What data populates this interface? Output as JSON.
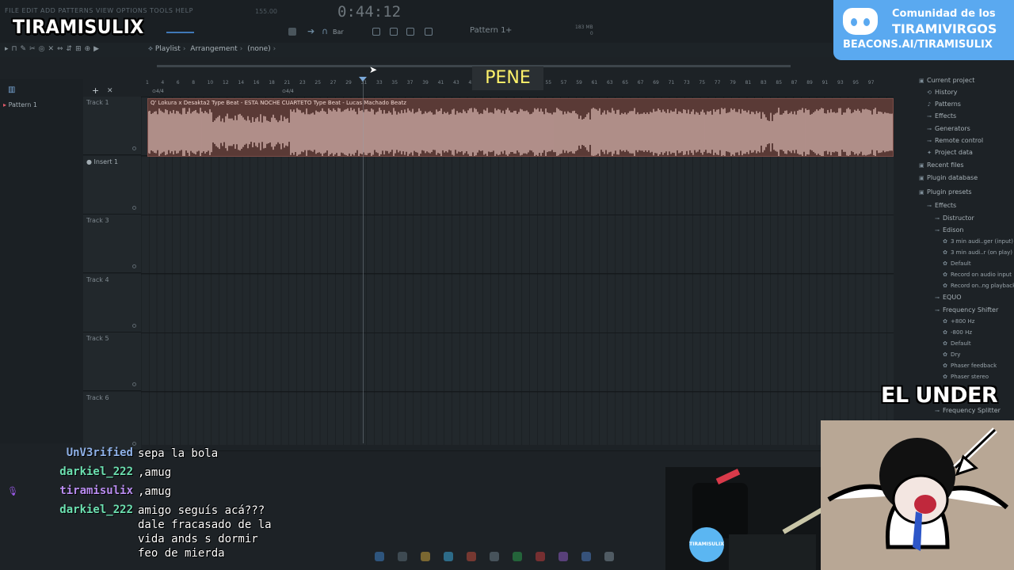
{
  "menu": {
    "text": "FILE  EDIT  ADD  PATTERNS  VIEW  OPTIONS  TOOLS  HELP"
  },
  "logo": "TIRAMISULIX",
  "transport": {
    "time": "0:44:12",
    "tempo_label": "155.00",
    "snap": "Bar",
    "pattern": "Pattern 1",
    "plus": "+",
    "memory_value": "183 MB",
    "memory_cpu": "0"
  },
  "breadcrumb": {
    "a": "Playlist",
    "b": "Arrangement",
    "c": "(none)"
  },
  "pattern_list": {
    "item": "Pattern 1"
  },
  "ruler": {
    "ticks": [
      "1",
      "4",
      "6",
      "8",
      "10",
      "12",
      "14",
      "16",
      "18",
      "21",
      "23",
      "25",
      "27",
      "29",
      "31",
      "33",
      "35",
      "37",
      "39",
      "41",
      "43",
      "45",
      "47",
      "49",
      "51",
      "53",
      "55",
      "57",
      "59",
      "61",
      "63",
      "65",
      "67",
      "69",
      "71",
      "73",
      "75",
      "77",
      "79",
      "81",
      "83",
      "85",
      "87",
      "89",
      "91",
      "93",
      "95",
      "97"
    ],
    "time_sig_a": "4/4",
    "time_sig_b": "4/4"
  },
  "tracks": [
    {
      "name": "Track 1"
    },
    {
      "name": "Insert 1"
    },
    {
      "name": "Track 3"
    },
    {
      "name": "Track 4"
    },
    {
      "name": "Track 5"
    },
    {
      "name": "Track 6"
    }
  ],
  "clip": {
    "title": "Q' Lokura x Desakta2 Type Beat - ESTA NOCHE  CUARTETO Type Beat - Lucas Machado Beatz"
  },
  "overlay": {
    "pene": "PENE",
    "el_under": "EL UNDER"
  },
  "browser": {
    "items": [
      {
        "label": "Current project",
        "icon": "folder-icon",
        "level": 0
      },
      {
        "label": "History",
        "icon": "history-icon",
        "level": 1
      },
      {
        "label": "Patterns",
        "icon": "pattern-icon",
        "level": 1
      },
      {
        "label": "Effects",
        "icon": "plug-icon",
        "level": 1
      },
      {
        "label": "Generators",
        "icon": "plug-icon",
        "level": 1
      },
      {
        "label": "Remote control",
        "icon": "plug-icon",
        "level": 1
      },
      {
        "label": "Project data",
        "icon": "data-icon",
        "level": 1
      },
      {
        "label": "Recent files",
        "icon": "folder-icon",
        "level": 0
      },
      {
        "label": "Plugin database",
        "icon": "folder-icon",
        "level": 0
      },
      {
        "label": "Plugin presets",
        "icon": "folder-icon",
        "level": 0
      },
      {
        "label": "Effects",
        "icon": "plug-icon",
        "level": 1
      },
      {
        "label": "Distructor",
        "icon": "plug-icon",
        "level": 2
      },
      {
        "label": "Edison",
        "icon": "plug-icon",
        "level": 2
      },
      {
        "label": "3 min audi..ger (input)",
        "icon": "gear-icon",
        "level": 3
      },
      {
        "label": "3 min audi..r (on play)",
        "icon": "gear-icon",
        "level": 3
      },
      {
        "label": "Default",
        "icon": "gear-icon",
        "level": 3
      },
      {
        "label": "Record on audio input",
        "icon": "gear-icon",
        "level": 3
      },
      {
        "label": "Record on..ng playback",
        "icon": "gear-icon",
        "level": 3
      },
      {
        "label": "EQUO",
        "icon": "plug-icon",
        "level": 2
      },
      {
        "label": "Frequency Shifter",
        "icon": "plug-icon",
        "level": 2
      },
      {
        "label": "+800 Hz",
        "icon": "gear-icon",
        "level": 3
      },
      {
        "label": "-800 Hz",
        "icon": "gear-icon",
        "level": 3
      },
      {
        "label": "Default",
        "icon": "gear-icon",
        "level": 3
      },
      {
        "label": "Dry",
        "icon": "gear-icon",
        "level": 3
      },
      {
        "label": "Phaser feedback",
        "icon": "gear-icon",
        "level": 3
      },
      {
        "label": "Phaser stereo",
        "icon": "gear-icon",
        "level": 3
      },
      {
        "label": "Frequency Splitter",
        "icon": "plug-icon",
        "level": 2
      }
    ]
  },
  "discord": {
    "line1": "Comunidad de los",
    "line2": "TIRAMIVIRGOS",
    "line3": "BEACONS.AI/TIRAMISULIX"
  },
  "chat": [
    {
      "user": "UnV3rified",
      "color": "#8fb1e8",
      "msg": "sepa la bola"
    },
    {
      "user": "darkiel_222",
      "color": "#6ce0b0",
      "msg": ",amug"
    },
    {
      "user": "tiramisulix",
      "color": "#b98cf0",
      "msg": ",amug"
    },
    {
      "user": "darkiel_222",
      "color": "#6ce0b0",
      "msg": "amigo seguís acá???\ndale fracasado de la\nvida ands s dormir\nfeo de mierda"
    }
  ],
  "sticker": {
    "text": "TIRAMISULIX"
  },
  "colors": {
    "clip_bg": "#5a3a36",
    "wave": "#e8c6c0",
    "discord": "#5aa9f0",
    "pene_text": "#fff36a"
  }
}
